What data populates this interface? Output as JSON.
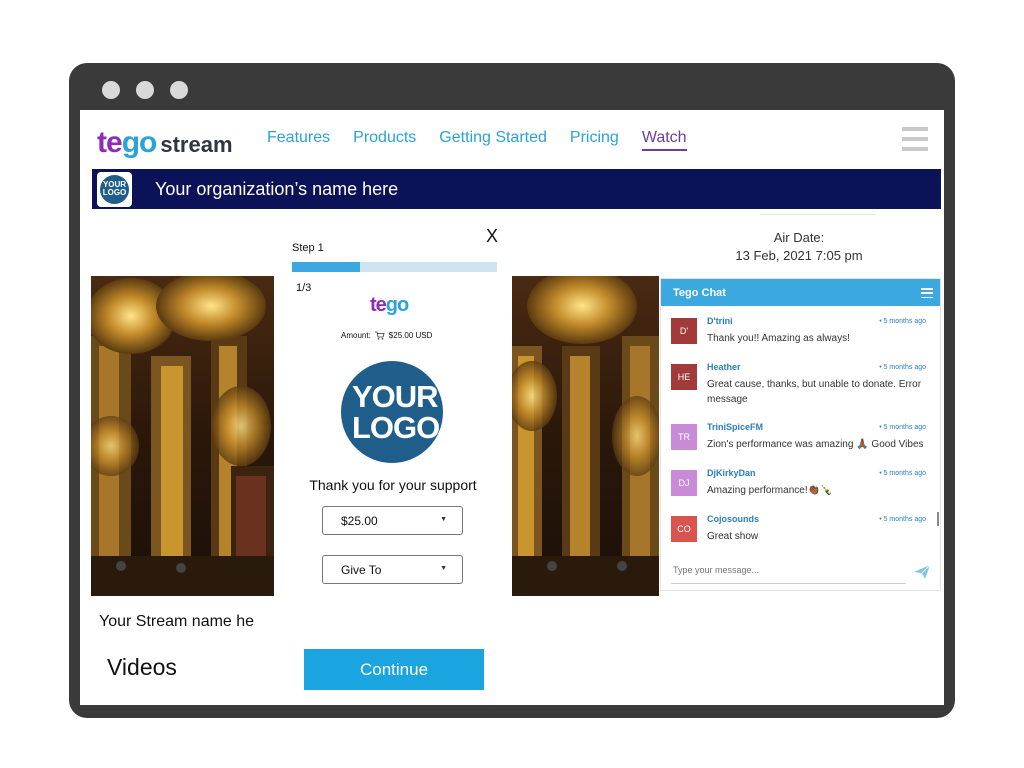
{
  "nav": {
    "logo_primary": "tego",
    "logo_secondary": "stream",
    "links": [
      {
        "label": "Features"
      },
      {
        "label": "Products"
      },
      {
        "label": "Getting Started"
      },
      {
        "label": "Pricing"
      },
      {
        "label": "Watch"
      }
    ],
    "active_link": "Watch"
  },
  "org_banner": {
    "logo_text": "YOUR LOGO",
    "name": "Your organization’s name here"
  },
  "air_date": {
    "label": "Air Date:",
    "value": "13 Feb, 2021 7:05 pm"
  },
  "stream": {
    "name": "Your Stream name he",
    "videos_heading": "Videos"
  },
  "modal": {
    "close_label": "X",
    "step_label": "Step 1",
    "step_count": "1/3",
    "progress_fraction": 0.33,
    "logo_text": "tego",
    "amount_label": "Amount:",
    "amount_value": "$25.00 USD",
    "placeholder_logo": "YOUR LOGO",
    "thanks_text": "Thank you for your support",
    "amount_select": "$25.00",
    "give_to_select": "Give To",
    "continue_label": "Continue"
  },
  "chat": {
    "title": "Tego Chat",
    "input_placeholder": "Type your message...",
    "messages": [
      {
        "initials": "D'",
        "user": "D'trini",
        "time": "• 5 months ago",
        "text": "Thank you!! Amazing as always!",
        "color": "#a33a3a"
      },
      {
        "initials": "HE",
        "user": "Heather",
        "time": "• 5 months ago",
        "text": "Great cause, thanks, but unable to donate. Error message",
        "color": "#a33a3a"
      },
      {
        "initials": "TR",
        "user": "TriniSpiceFM",
        "time": "• 5 months ago",
        "text": "Zion's performance was amazing 🙏🏾 Good Vibes",
        "color": "#c98bd8"
      },
      {
        "initials": "DJ",
        "user": "DjKirkyDan",
        "time": "• 5 months ago",
        "text": "Amazing performance!👏🏾🍾",
        "color": "#c98bd8"
      },
      {
        "initials": "CO",
        "user": "Cojosounds",
        "time": "• 5 months ago",
        "text": "Great show",
        "color": "#d9534f"
      }
    ]
  },
  "colors": {
    "brand_purple": "#8e2bb8",
    "brand_blue": "#2aa3d6",
    "banner_navy": "#0b1257",
    "chat_header": "#3ba9e0"
  }
}
